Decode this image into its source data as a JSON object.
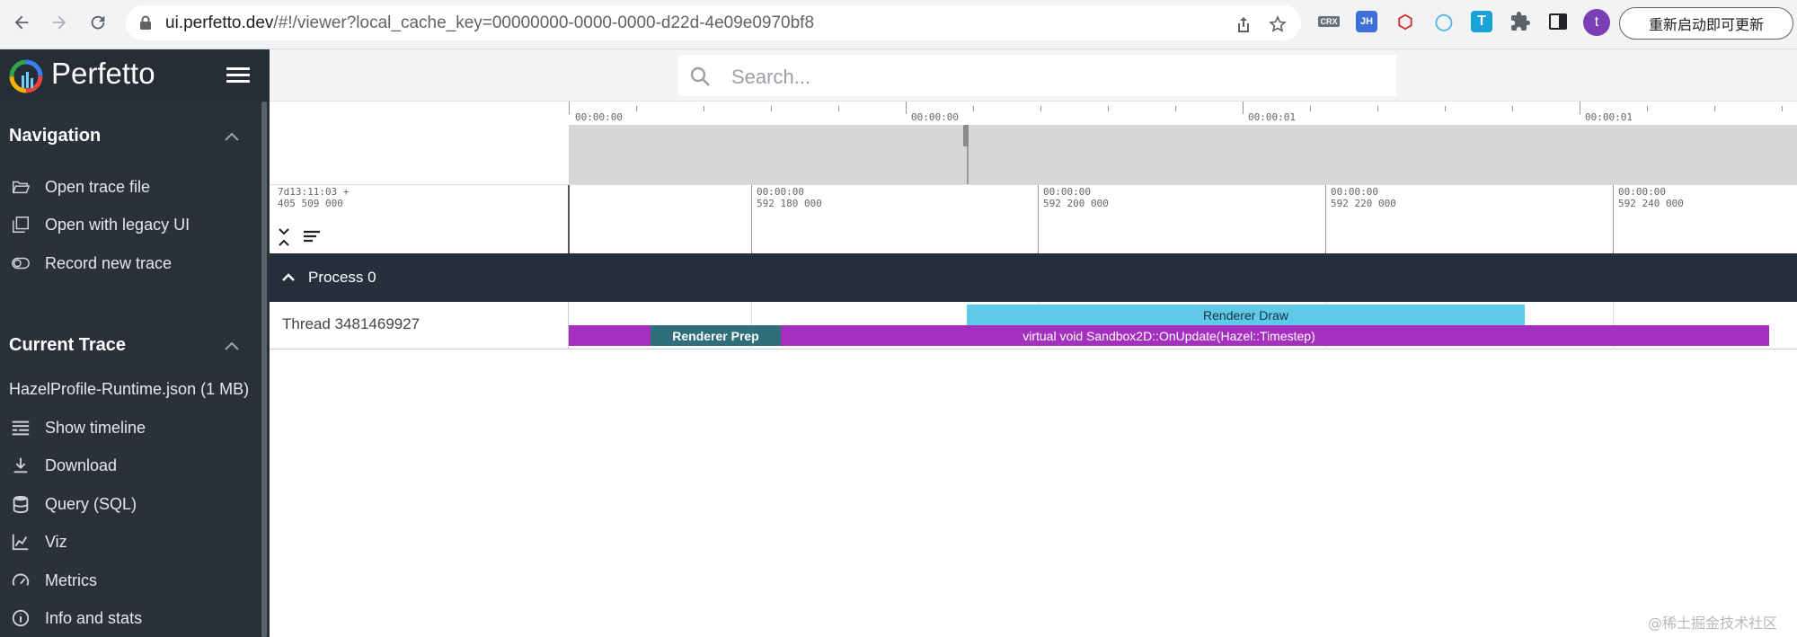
{
  "browser": {
    "url_host": "ui.perfetto.dev",
    "url_rest": "/#!/viewer?local_cache_key=00000000-0000-0000-d22d-4e09e0970bf8",
    "avatar_letter": "t",
    "update_button": "重新启动即可更新",
    "extensions": [
      {
        "icon": "crx-icon",
        "label": "CRX",
        "color": "#6b7078"
      },
      {
        "icon": "jh-icon",
        "label": "JH",
        "color": "#3f6fd8"
      },
      {
        "icon": "hex-icon",
        "label": "⬡",
        "color": "#d6312b"
      },
      {
        "icon": "ring-icon",
        "label": "◯",
        "color": "#58b4e6"
      },
      {
        "icon": "t-icon",
        "label": "T",
        "color": "#1aa3d8"
      }
    ]
  },
  "app": {
    "name": "Perfetto"
  },
  "sidebar": {
    "navigation_title": "Navigation",
    "navigation_items": [
      {
        "label": "Open trace file",
        "icon": "folder-open-icon"
      },
      {
        "label": "Open with legacy UI",
        "icon": "filter-none-icon"
      },
      {
        "label": "Record new trace",
        "icon": "record-icon"
      }
    ],
    "current_trace_title": "Current Trace",
    "trace_name": "HazelProfile-Runtime.json (1 MB)",
    "trace_items": [
      {
        "label": "Show timeline",
        "icon": "timeline-icon"
      },
      {
        "label": "Download",
        "icon": "download-icon"
      },
      {
        "label": "Query (SQL)",
        "icon": "database-icon"
      },
      {
        "label": "Viz",
        "icon": "chart-icon"
      },
      {
        "label": "Metrics",
        "icon": "speed-icon"
      },
      {
        "label": "Info and stats",
        "icon": "info-icon"
      }
    ]
  },
  "search": {
    "placeholder": "Search..."
  },
  "overview": {
    "labels": [
      "00:00:00",
      "00:00:00",
      "00:00:01",
      "00:00:01"
    ]
  },
  "timeaxis": {
    "offset_line1": "7d13:11:03  +",
    "offset_line2": "405 509 000",
    "ticks": [
      {
        "top": "00:00:00",
        "bottom": "592 180 000"
      },
      {
        "top": "00:00:00",
        "bottom": "592 200 000"
      },
      {
        "top": "00:00:00",
        "bottom": "592 220 000"
      },
      {
        "top": "00:00:00",
        "bottom": "592 240 000"
      }
    ]
  },
  "tracks": {
    "process": "Process 0",
    "thread": "Thread 3481469927",
    "slices": {
      "draw": "Renderer Draw",
      "update": "virtual void Sandbox2D::OnUpdate(Hazel::Timestep)",
      "prep": "Renderer Prep"
    }
  },
  "watermark": "@稀土掘金技术社区"
}
